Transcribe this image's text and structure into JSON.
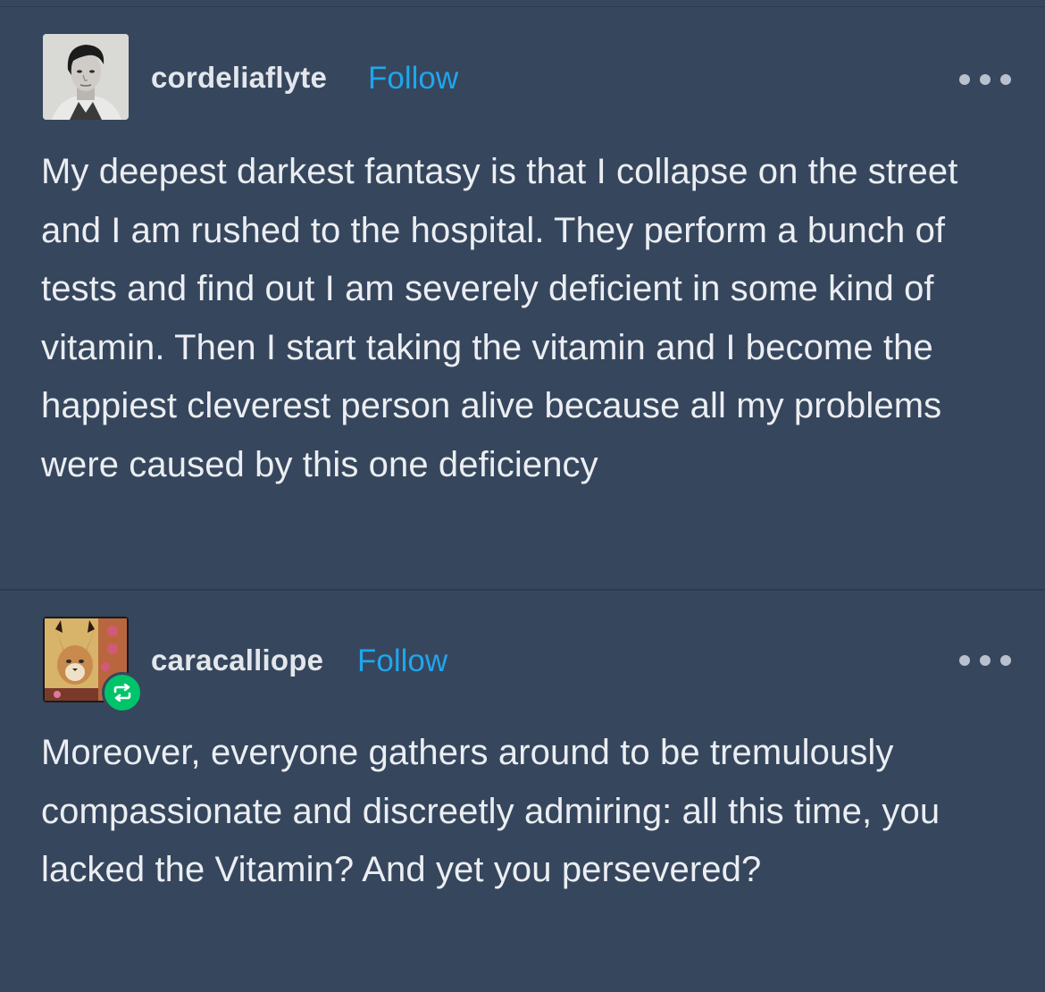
{
  "posts": [
    {
      "username": "cordeliaflyte",
      "follow_label": "Follow",
      "avatar_icon": "portrait-photo-avatar",
      "menu_icon": "more-options-icon",
      "body": "My deepest darkest fantasy is that I collapse on the street and I am rushed to the hospital. They perform a bunch of tests and find out I am severely deficient in some kind of vitamin. Then I start taking the vitamin and I become the happiest cleverest person alive because all my problems were caused by this one deficiency"
    },
    {
      "username": "caracalliope",
      "follow_label": "Follow",
      "avatar_icon": "caracal-illustration-avatar",
      "badge_icon": "reblog-icon",
      "menu_icon": "more-options-icon",
      "body": "Moreover, everyone gathers around to be tremulously compassionate and discreetly admiring: all this time, you lacked the Vitamin? And yet you persevered?"
    }
  ],
  "colors": {
    "background": "#36465d",
    "follow": "#1fa6ee",
    "reblog_badge": "#00c46a",
    "text": "#ebeef2"
  }
}
